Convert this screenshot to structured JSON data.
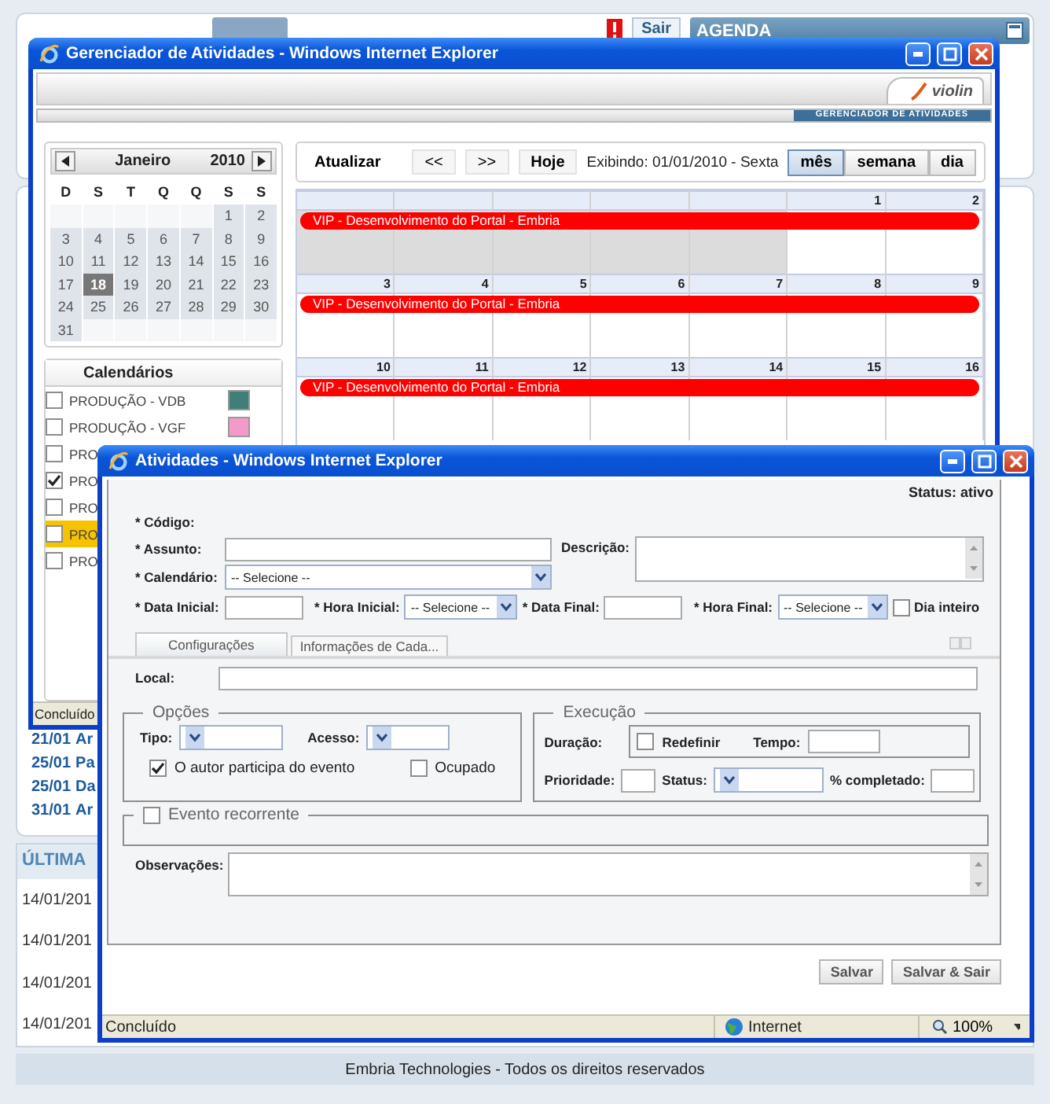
{
  "portal": {
    "logout": "Sair",
    "agenda_title": "AGENDA",
    "agenda_items": [
      {
        "date": "21/01",
        "title": "Ar"
      },
      {
        "date": "25/01",
        "title": "Pa"
      },
      {
        "date": "25/01",
        "title": "Da"
      },
      {
        "date": "31/01",
        "title": "Ar"
      }
    ],
    "latest_title": "ÚLTIMA",
    "latest_items": [
      "14/01/201",
      "14/01/201",
      "14/01/201",
      "14/01/201"
    ],
    "footer": "Embria Technologies - Todos os direitos reservados"
  },
  "manager": {
    "title": "Gerenciador de Atividades - Windows Internet Explorer",
    "logo": "violin",
    "banner": "GERENCIADOR DE ATIVIDADES",
    "mini_calendar": {
      "month": "Janeiro",
      "year": "2010",
      "weekdays": [
        "D",
        "S",
        "T",
        "Q",
        "Q",
        "S",
        "S"
      ],
      "weeks": [
        [
          {
            "outside": true
          },
          {
            "outside": true
          },
          {
            "outside": true
          },
          {
            "outside": true
          },
          {
            "outside": true
          },
          {
            "day": "1",
            "selected": false
          },
          {
            "day": "2",
            "selected": false
          }
        ],
        [
          {
            "day": "3",
            "selected": false
          },
          {
            "day": "4",
            "selected": false
          },
          {
            "day": "5",
            "selected": false
          },
          {
            "day": "6",
            "selected": false
          },
          {
            "day": "7",
            "selected": false
          },
          {
            "day": "8",
            "selected": false
          },
          {
            "day": "9",
            "selected": false
          }
        ],
        [
          {
            "day": "10",
            "selected": false
          },
          {
            "day": "11",
            "selected": false
          },
          {
            "day": "12",
            "selected": false
          },
          {
            "day": "13",
            "selected": false
          },
          {
            "day": "14",
            "selected": false
          },
          {
            "day": "15",
            "selected": false
          },
          {
            "day": "16",
            "selected": false
          }
        ],
        [
          {
            "day": "17",
            "selected": false
          },
          {
            "day": "18",
            "selected": true
          },
          {
            "day": "19",
            "selected": false
          },
          {
            "day": "20",
            "selected": false
          },
          {
            "day": "21",
            "selected": false
          },
          {
            "day": "22",
            "selected": false
          },
          {
            "day": "23",
            "selected": false
          }
        ],
        [
          {
            "day": "24",
            "selected": false
          },
          {
            "day": "25",
            "selected": false
          },
          {
            "day": "26",
            "selected": false
          },
          {
            "day": "27",
            "selected": false
          },
          {
            "day": "28",
            "selected": false
          },
          {
            "day": "29",
            "selected": false
          },
          {
            "day": "30",
            "selected": false
          }
        ],
        [
          {
            "day": "31",
            "selected": false
          },
          {
            "outside": true
          },
          {
            "outside": true
          },
          {
            "outside": true
          },
          {
            "outside": true
          },
          {
            "outside": true
          },
          {
            "outside": true
          }
        ]
      ]
    },
    "calendars": {
      "title": "Calendários",
      "items": [
        {
          "name": "PRODUÇÃO - VDB",
          "checked": false,
          "selected": false,
          "color": "#3f7f77"
        },
        {
          "name": "PRODUÇÃO - VGF",
          "checked": false,
          "selected": false,
          "color": "#f49ac8"
        },
        {
          "name": "PRO",
          "checked": false,
          "selected": false
        },
        {
          "name": "PRO",
          "checked": true,
          "selected": false
        },
        {
          "name": "PRO",
          "checked": false,
          "selected": false
        },
        {
          "name": "PRO",
          "checked": false,
          "selected": true
        },
        {
          "name": "PRO",
          "checked": false,
          "selected": false
        }
      ]
    },
    "toolbar": {
      "refresh": "Atualizar",
      "previous": "<<",
      "next": ">>",
      "today": "Hoje",
      "showing": "Exibindo: 01/01/2010 - Sexta",
      "views": [
        {
          "label": "mês",
          "selected": true
        },
        {
          "label": "semana",
          "selected": false
        },
        {
          "label": "dia",
          "selected": false
        }
      ]
    },
    "month_grid": [
      {
        "days": [
          {
            "outside": true
          },
          {
            "outside": true
          },
          {
            "outside": true
          },
          {
            "outside": true
          },
          {
            "outside": true
          },
          {
            "day": "1",
            "outside": false
          },
          {
            "day": "2",
            "outside": false
          }
        ],
        "events": [
          "VIP - Desenvolvimento do Portal - Embria"
        ]
      },
      {
        "days": [
          {
            "day": "3",
            "outside": false
          },
          {
            "day": "4",
            "outside": false
          },
          {
            "day": "5",
            "outside": false
          },
          {
            "day": "6",
            "outside": false
          },
          {
            "day": "7",
            "outside": false
          },
          {
            "day": "8",
            "outside": false
          },
          {
            "day": "9",
            "outside": false
          }
        ],
        "events": [
          "VIP - Desenvolvimento do Portal - Embria"
        ]
      },
      {
        "days": [
          {
            "day": "10",
            "outside": false
          },
          {
            "day": "11",
            "outside": false
          },
          {
            "day": "12",
            "outside": false
          },
          {
            "day": "13",
            "outside": false
          },
          {
            "day": "14",
            "outside": false
          },
          {
            "day": "15",
            "outside": false
          },
          {
            "day": "16",
            "outside": false
          }
        ],
        "events": [
          "VIP - Desenvolvimento do Portal - Embria"
        ]
      }
    ],
    "status_bar": "Concluído"
  },
  "activity": {
    "title": "Atividades - Windows Internet Explorer",
    "status": "Status: ativo",
    "code_label": "* Código:",
    "subject_label": "* Assunto:",
    "description_label": "Descrição:",
    "calendar_label": "* Calendário:",
    "calendar_value": "-- Selecione --",
    "start_date_label": "* Data Inicial:",
    "start_time_label": "* Hora Inicial:",
    "start_time_value": "-- Selecione --",
    "end_date_label": "* Data Final:",
    "end_time_label": "* Hora Final:",
    "end_time_value": "-- Selecione --",
    "all_day": {
      "label": "Dia inteiro",
      "checked": false
    },
    "tabs": [
      {
        "label": "Configurações",
        "selected": true
      },
      {
        "label": "Informações de Cada...",
        "selected": false
      }
    ],
    "local_label": "Local:",
    "options": {
      "legend": "Opções",
      "type_label": "Tipo:",
      "access_label": "Acesso:",
      "checkboxes": [
        {
          "label": "O autor participa do evento",
          "checked": true
        },
        {
          "label": "Ocupado",
          "checked": false
        }
      ]
    },
    "execution": {
      "legend": "Execução",
      "duration_label": "Duração:",
      "reset": {
        "label": "Redefinir",
        "checked": false
      },
      "time_label": "Tempo:",
      "priority_label": "Prioridade:",
      "status_label": "Status:",
      "percent_label": "% completado:"
    },
    "recurring": {
      "label": "Evento recorrente",
      "checked": false
    },
    "notes_label": "Observações:",
    "buttons": [
      "Salvar",
      "Salvar & Sair"
    ],
    "status_bar": {
      "left": "Concluído",
      "zone": "Internet",
      "zoom": "100%"
    }
  }
}
